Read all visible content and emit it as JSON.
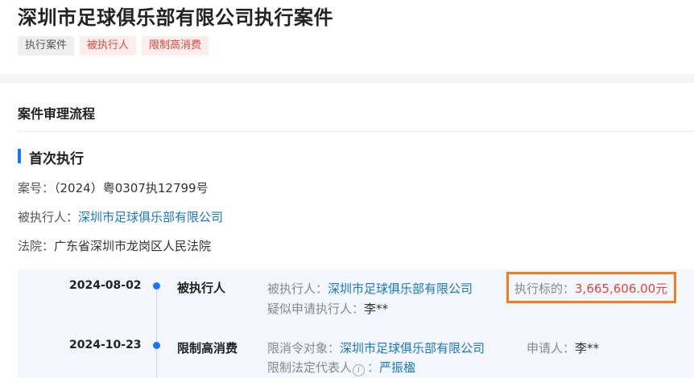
{
  "header": {
    "title": "深圳市足球俱乐部有限公司执行案件",
    "tags": [
      "执行案件",
      "被执行人",
      "限制高消费"
    ]
  },
  "process": {
    "title": "案件审理流程",
    "stage_title": "首次执行",
    "case_no_label": "案号：",
    "case_no": "（2024）粤0307执12799号",
    "executed_label": "被执行人：",
    "executed": "深圳市足球俱乐部有限公司",
    "court_label": "法院：",
    "court": "广东省深圳市龙岗区人民法院"
  },
  "timeline": [
    {
      "date": "2024-08-02",
      "type": "被执行人",
      "executed_label": "被执行人：",
      "executed": "深圳市足球俱乐部有限公司",
      "applicant_label": "疑似申请执行人：",
      "applicant": "李**",
      "target_label": "执行标的：",
      "target": "3,665,606.00元"
    },
    {
      "date": "2024-10-23",
      "type": "限制高消费",
      "object_label": "限消令对象：",
      "object": "深圳市足球俱乐部有限公司",
      "applicant_label": "申请人：",
      "applicant": "李**",
      "legal_rep_label": "限制法定代表人",
      "legal_rep_colon": "：",
      "legal_rep": "严振楹"
    }
  ],
  "colors": {
    "accent": "#1677ff",
    "link": "#1a78c2",
    "red": "#e0463d",
    "highlight_border": "#f07d22"
  }
}
